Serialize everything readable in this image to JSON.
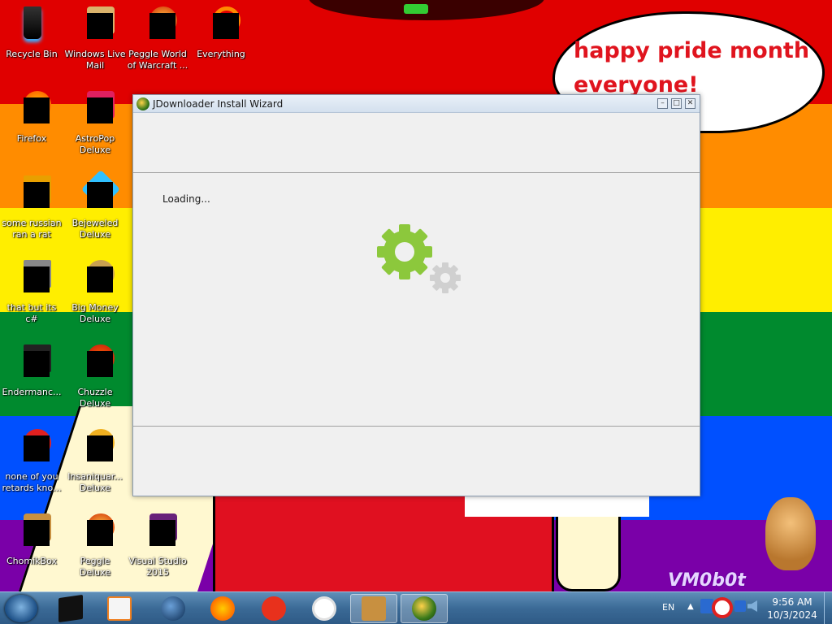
{
  "desktop": {
    "speech_bubble": "happy pride month everyone!",
    "watermark": "VM0b0t",
    "icons": [
      {
        "label": "Recycle Bin",
        "icon": "recycle-bin-icon"
      },
      {
        "label": "Windows Live Mail",
        "icon": "mail-icon"
      },
      {
        "label": "Peggle World of Warcraft ...",
        "icon": "peggle-icon"
      },
      {
        "label": "Everything",
        "icon": "search-icon"
      },
      {
        "label": "Firefox",
        "icon": "firefox-icon"
      },
      {
        "label": "AstroPop Deluxe",
        "icon": "game-icon"
      },
      {
        "label": "some russian ran a rat",
        "icon": "app-icon"
      },
      {
        "label": "Bejeweled Deluxe",
        "icon": "gem-icon"
      },
      {
        "label": "that but its c#",
        "icon": "app-icon"
      },
      {
        "label": "Big Money Deluxe",
        "icon": "money-icon"
      },
      {
        "label": "Endermanc...",
        "icon": "app-icon"
      },
      {
        "label": "Chuzzle Deluxe",
        "icon": "game-icon"
      },
      {
        "label": "none of you retards kno...",
        "icon": "app-icon"
      },
      {
        "label": "Insaniquar... Deluxe",
        "icon": "fish-icon"
      },
      {
        "label": "ChomikBox",
        "icon": "hamster-icon"
      },
      {
        "label": "Peggle Deluxe",
        "icon": "peggle-icon"
      },
      {
        "label": "Visual Studio 2015",
        "icon": "visual-studio-icon"
      }
    ]
  },
  "window": {
    "title": "JDownloader Install Wizard",
    "minimize": "–",
    "maximize": "□",
    "close": "✕",
    "status": "Loading..."
  },
  "taskbar": {
    "language": "EN",
    "tray_arrow": "▲",
    "time": "9:56 AM",
    "date": "10/3/2024",
    "apps": [
      {
        "icon": "explorer-icon",
        "active": false
      },
      {
        "icon": "media-player-icon",
        "active": false
      },
      {
        "icon": "globe-icon",
        "active": false
      },
      {
        "icon": "firefox-icon",
        "active": false
      },
      {
        "icon": "yandex-icon",
        "active": false
      },
      {
        "icon": "yandex-browser-icon",
        "active": false
      },
      {
        "icon": "chomikbox-icon",
        "active": true
      },
      {
        "icon": "jdownloader-icon",
        "active": true
      }
    ]
  },
  "colors": {
    "red": "#e00000",
    "orange": "#ff8c00",
    "yellow": "#ffee00",
    "green": "#008a2e",
    "blue": "#0050ff",
    "purple": "#7a00a8",
    "gear_green": "#8cc83c",
    "gear_gray": "#d0d0d0"
  }
}
